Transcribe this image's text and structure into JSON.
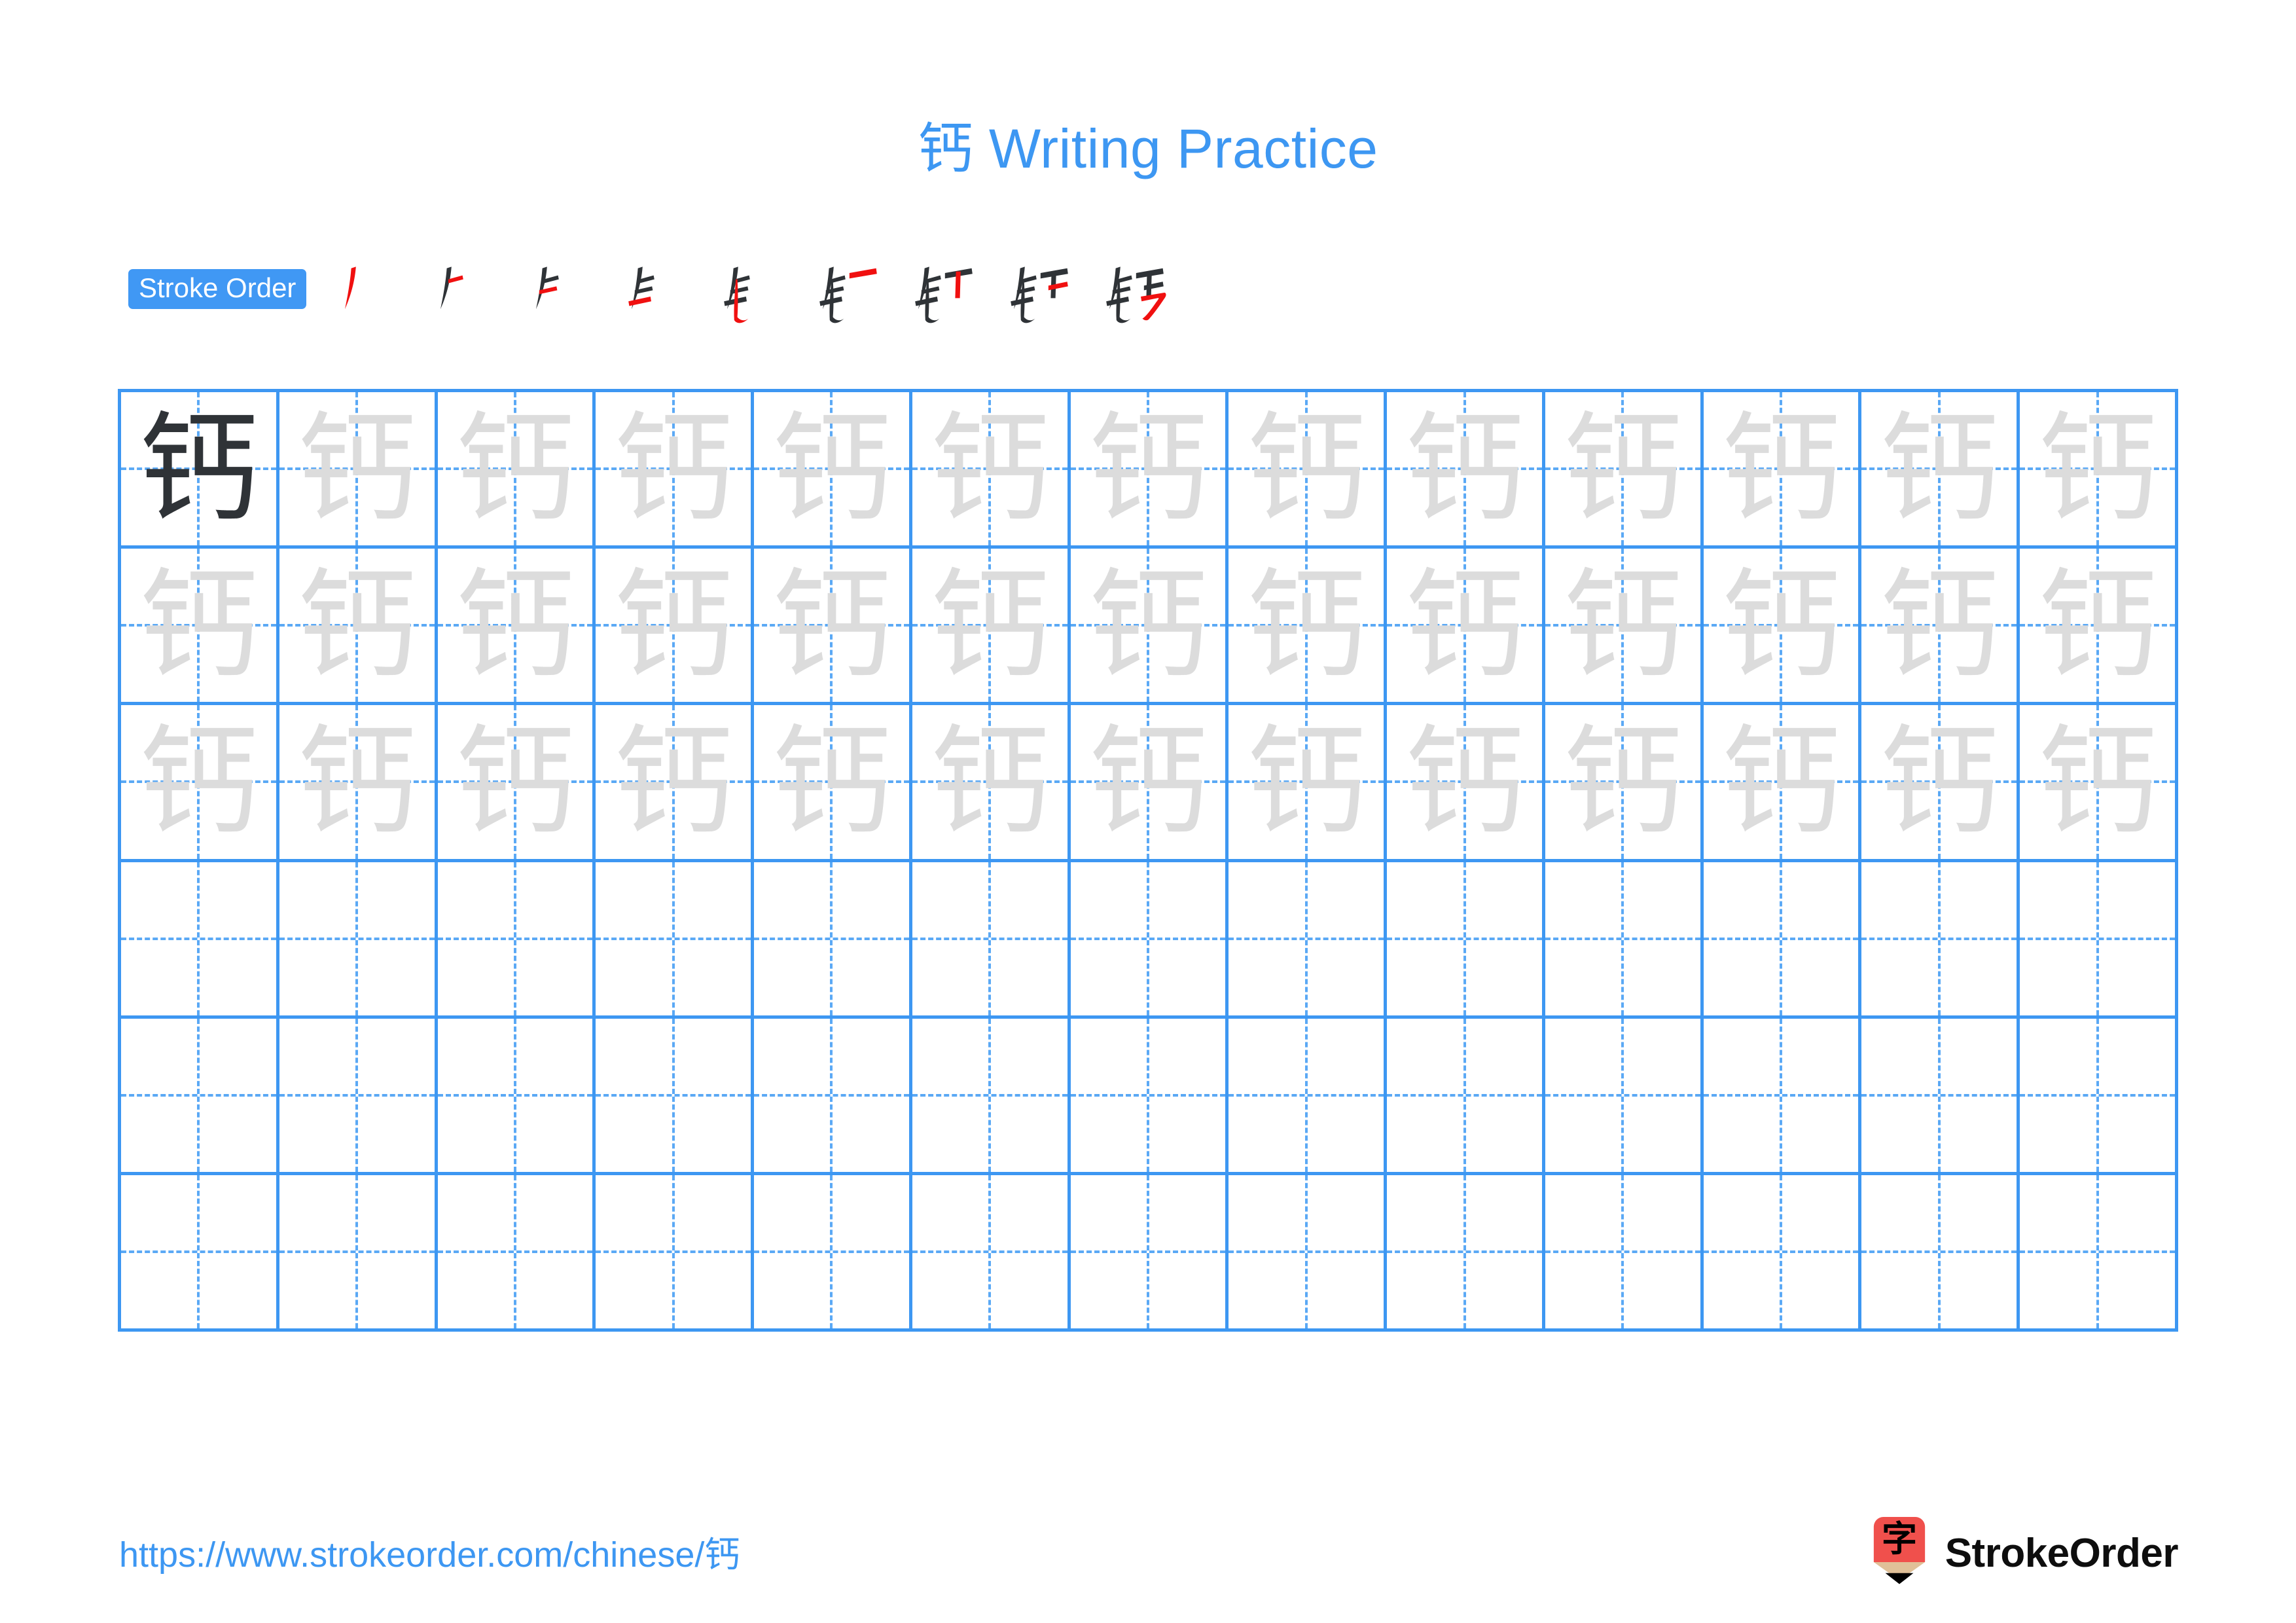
{
  "page": {
    "character": "钙",
    "title": "钙 Writing Practice",
    "accent_color": "#3D97F2",
    "badge_color": "#4098F4",
    "trace_color": "#DCDCDC",
    "ink_color": "#2F3337",
    "highlight_color": "#F01010"
  },
  "stroke_order": {
    "label": "Stroke Order",
    "total_strokes": 9,
    "steps": [
      {
        "index": 1,
        "new_stroke": "撇 (left-falling)",
        "glyph": "丿"
      },
      {
        "index": 2,
        "new_stroke": "横 (horizontal tick)",
        "glyph": "𠂊"
      },
      {
        "index": 3,
        "new_stroke": "横 (horizontal)",
        "glyph": "⺈"
      },
      {
        "index": 4,
        "new_stroke": "横 (horizontal)",
        "glyph": "钅"
      },
      {
        "index": 5,
        "new_stroke": "竖提 (vertical-rise)",
        "glyph": "钅"
      },
      {
        "index": 6,
        "new_stroke": "横 (horizontal of 丂)",
        "glyph": "钅一"
      },
      {
        "index": 7,
        "new_stroke": "竖 (vertical)",
        "glyph": "钉"
      },
      {
        "index": 8,
        "new_stroke": "横 (second horizontal)",
        "glyph": "钎"
      },
      {
        "index": 9,
        "new_stroke": "横折弯钩 (hook)",
        "glyph": "钙"
      }
    ]
  },
  "practice_grid": {
    "columns": 13,
    "rows": 6,
    "guides": "dashed-crosshair",
    "cells": [
      [
        "dark",
        "trace",
        "trace",
        "trace",
        "trace",
        "trace",
        "trace",
        "trace",
        "trace",
        "trace",
        "trace",
        "trace",
        "trace"
      ],
      [
        "trace",
        "trace",
        "trace",
        "trace",
        "trace",
        "trace",
        "trace",
        "trace",
        "trace",
        "trace",
        "trace",
        "trace",
        "trace"
      ],
      [
        "trace",
        "trace",
        "trace",
        "trace",
        "trace",
        "trace",
        "trace",
        "trace",
        "trace",
        "trace",
        "trace",
        "trace",
        "trace"
      ],
      [
        "blank",
        "blank",
        "blank",
        "blank",
        "blank",
        "blank",
        "blank",
        "blank",
        "blank",
        "blank",
        "blank",
        "blank",
        "blank"
      ],
      [
        "blank",
        "blank",
        "blank",
        "blank",
        "blank",
        "blank",
        "blank",
        "blank",
        "blank",
        "blank",
        "blank",
        "blank",
        "blank"
      ],
      [
        "blank",
        "blank",
        "blank",
        "blank",
        "blank",
        "blank",
        "blank",
        "blank",
        "blank",
        "blank",
        "blank",
        "blank",
        "blank"
      ]
    ]
  },
  "footer": {
    "url": "https://www.strokeorder.com/chinese/钙",
    "brand_name": "StrokeOrder",
    "brand_mark_character": "字",
    "brand_mark_body_color": "#F0504C",
    "brand_mark_wood_color": "#E0C098",
    "brand_mark_tip_color": "#000000"
  }
}
